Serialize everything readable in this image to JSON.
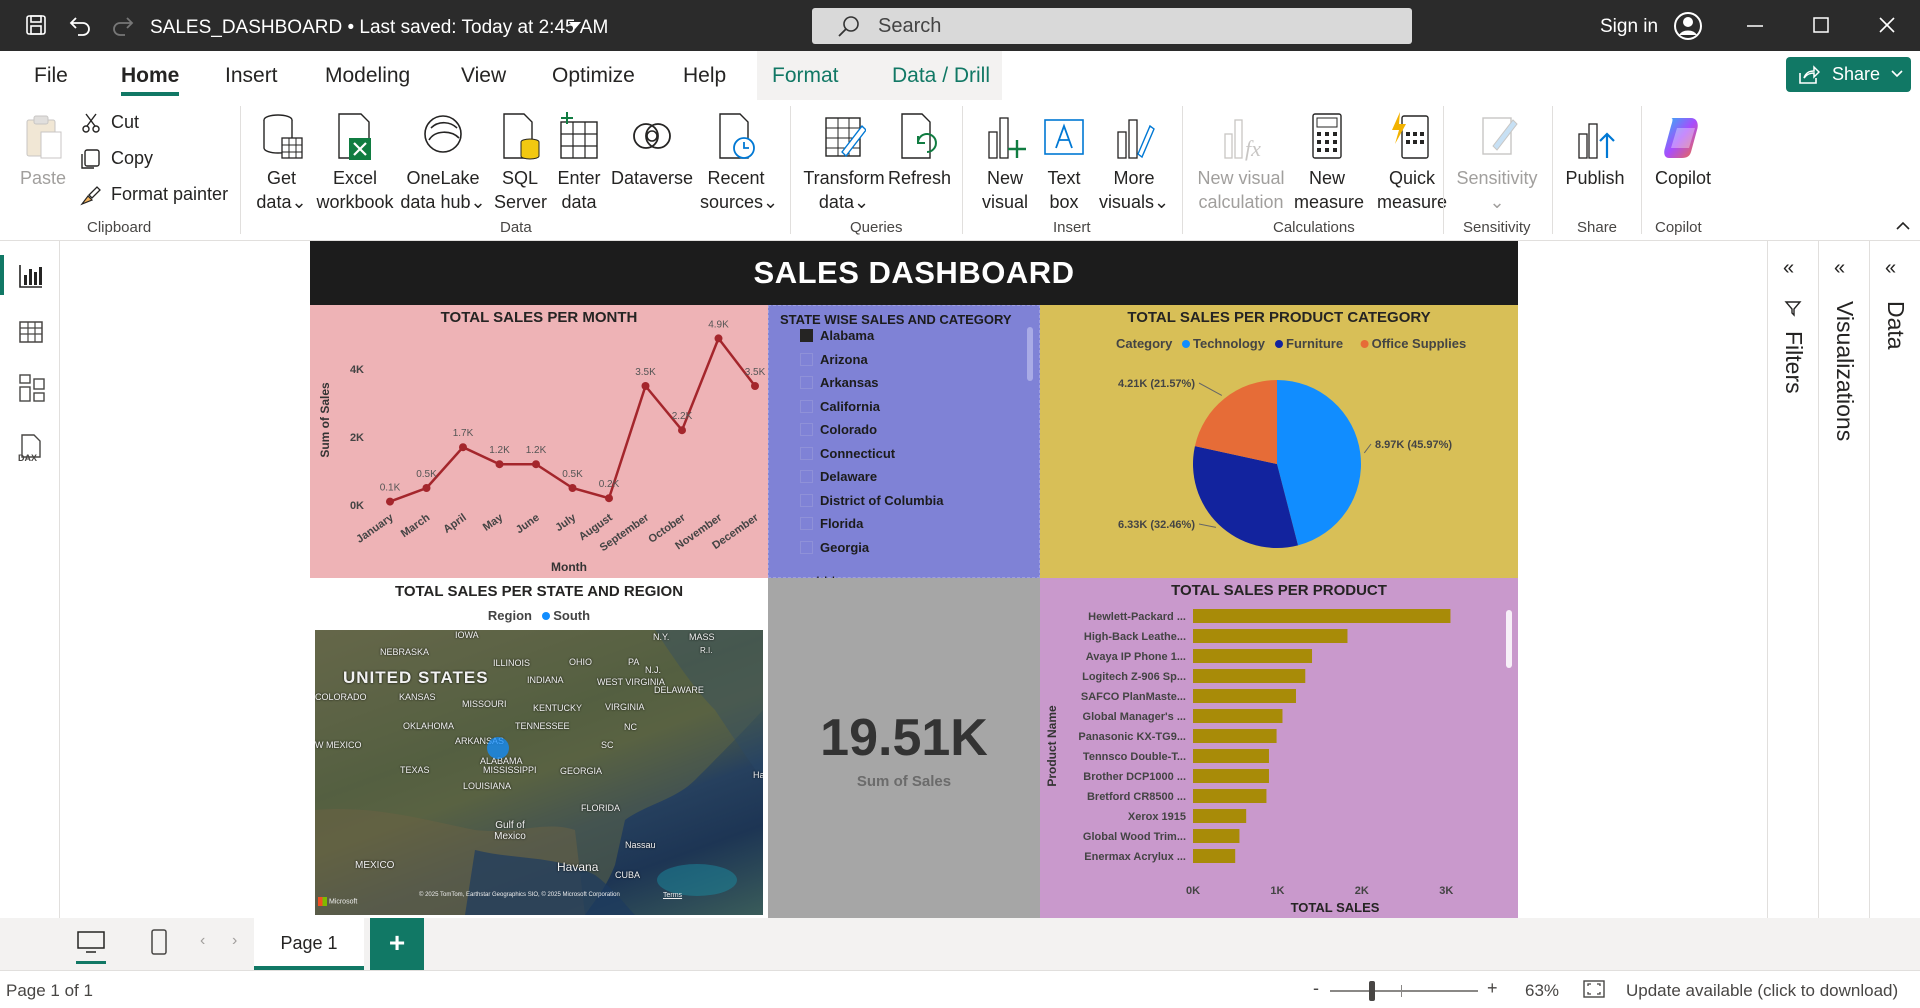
{
  "titlebar": {
    "doc_title": "SALES_DASHBOARD • Last saved: Today at 2:45 AM",
    "search_placeholder": "Search",
    "signin": "Sign in"
  },
  "menu": {
    "items": [
      "File",
      "Home",
      "Insert",
      "Modeling",
      "View",
      "Optimize",
      "Help",
      "Format",
      "Data / Drill"
    ],
    "share": "Share"
  },
  "ribbon": {
    "clipboard": {
      "paste": "Paste",
      "cut": "Cut",
      "copy": "Copy",
      "format_painter": "Format painter",
      "group": "Clipboard"
    },
    "data": {
      "get_data": [
        "Get",
        "data"
      ],
      "excel": [
        "Excel",
        "workbook"
      ],
      "onelake": [
        "OneLake",
        "data hub"
      ],
      "sql": [
        "SQL",
        "Server"
      ],
      "enter": [
        "Enter",
        "data"
      ],
      "dataverse": "Dataverse",
      "recent": [
        "Recent",
        "sources"
      ],
      "group": "Data"
    },
    "queries": {
      "transform": [
        "Transform",
        "data"
      ],
      "refresh": "Refresh",
      "group": "Queries"
    },
    "insert": {
      "new_visual": [
        "New",
        "visual"
      ],
      "text_box": [
        "Text",
        "box"
      ],
      "more_visuals": [
        "More",
        "visuals"
      ],
      "group": "Insert"
    },
    "calculations": {
      "new_visual_calc": [
        "New visual",
        "calculation"
      ],
      "new_measure": [
        "New",
        "measure"
      ],
      "quick_measure": [
        "Quick",
        "measure"
      ],
      "group": "Calculations"
    },
    "sensitivity": {
      "label": "Sensitivity",
      "group": "Sensitivity"
    },
    "share": {
      "publish": "Publish",
      "group": "Share"
    },
    "copilot": {
      "label": "Copilot",
      "group": "Copilot"
    }
  },
  "panes": {
    "filters": "Filters",
    "visualizations": "Visualizations",
    "data": "Data"
  },
  "report": {
    "title": "SALES DASHBOARD",
    "slicer": {
      "title": "STATE WISE SALES AND CATEGORY",
      "items": [
        "Alabama",
        "Arizona",
        "Arkansas",
        "California",
        "Colorado",
        "Connecticut",
        "Delaware",
        "District of Columbia",
        "Florida",
        "Georgia"
      ],
      "checked": [
        true,
        false,
        false,
        false,
        false,
        false,
        false,
        false,
        false,
        false
      ]
    },
    "card": {
      "value": "19.51K",
      "label": "Sum of Sales"
    },
    "map": {
      "title": "TOTAL SALES PER STATE AND REGION",
      "legend_title": "Region",
      "legend_item": "South",
      "legend_color": "#118dff",
      "labels": [
        "NEBRASKA",
        "IOWA",
        "N.Y.",
        "MASS",
        "R.I.",
        "ILLINOIS",
        "OHIO",
        "PA",
        "N.J.",
        "UNITED STATES",
        "INDIANA",
        "WEST VIRGINIA",
        "DELAWARE",
        "COLORADO",
        "KANSAS",
        "MISSOURI",
        "KENTUCKY",
        "VIRGINIA",
        "OKLAHOMA",
        "TENNESSEE",
        "NC",
        "ARKANSAS",
        "W MEXICO",
        "SC",
        "TEXAS",
        "MISSISSIPPI",
        "ALABAMA",
        "GEORGIA",
        "LOUISIANA",
        "FLORIDA",
        "Gulf of Mexico",
        "Nassau",
        "MEXICO",
        "Havana",
        "CUBA",
        "Ha"
      ],
      "attribution": "© 2025 TomTom, Earthstar Geographics SIO, © 2025 Microsoft Corporation",
      "terms": "Terms",
      "ms_logo": "Microsoft"
    }
  },
  "chart_data": [
    {
      "type": "line",
      "title": "TOTAL SALES PER MONTH",
      "xlabel": "Month",
      "ylabel": "Sum of Sales",
      "categories": [
        "January",
        "March",
        "April",
        "May",
        "June",
        "July",
        "August",
        "September",
        "October",
        "November",
        "December"
      ],
      "values": [
        0.1,
        0.5,
        1.7,
        1.2,
        1.2,
        0.5,
        0.2,
        3.5,
        2.2,
        4.9,
        3.5
      ],
      "labels": [
        "0.1K",
        "0.5K",
        "1.7K",
        "1.2K",
        "1.2K",
        "0.5K",
        "0.2K",
        "3.5K",
        "2.2K",
        "4.9K",
        "3.5K"
      ],
      "yticks": [
        "0K",
        "2K",
        "4K"
      ],
      "ylim": [
        0,
        5
      ],
      "color": "#a4262c",
      "background": "#eeb3b6"
    },
    {
      "type": "pie",
      "title": "TOTAL SALES PER PRODUCT CATEGORY",
      "legend_title": "Category",
      "categories": [
        "Technology",
        "Furniture",
        "Office Supplies"
      ],
      "values": [
        8.97,
        6.33,
        4.21
      ],
      "labels": [
        "8.97K (45.97%)",
        "6.33K (32.46%)",
        "4.21K (21.57%)"
      ],
      "colors": [
        "#118dff",
        "#12239e",
        "#e66c37"
      ],
      "background": "#d8bf57"
    },
    {
      "type": "bar",
      "orientation": "horizontal",
      "title": "TOTAL SALES PER PRODUCT",
      "xlabel": "TOTAL SALES",
      "ylabel": "Product Name",
      "categories": [
        "Hewlett-Packard ...",
        "High-Back Leathe...",
        "Avaya IP Phone 1...",
        "Logitech Z-906 Sp...",
        "SAFCO PlanMaste...",
        "Global Manager's ...",
        "Panasonic KX-TG9...",
        "Tennsco Double-T...",
        "Brother DCP1000 ...",
        "Bretford CR8500 ...",
        "Xerox 1915",
        "Global Wood Trim...",
        "Enermax Acrylux ..."
      ],
      "values": [
        3.05,
        1.83,
        1.41,
        1.33,
        1.22,
        1.06,
        0.99,
        0.9,
        0.9,
        0.87,
        0.63,
        0.55,
        0.5
      ],
      "xticks": [
        "0K",
        "1K",
        "2K",
        "3K"
      ],
      "xlim": [
        0,
        3.4
      ],
      "color": "#a88b08",
      "background": "#c999cc"
    }
  ],
  "pages": {
    "tab": "Page 1",
    "add": "+"
  },
  "status": {
    "page_info": "Page 1 of 1",
    "zoom": "63%",
    "update": "Update available (click to download)",
    "minus": "-",
    "plus": "+"
  }
}
